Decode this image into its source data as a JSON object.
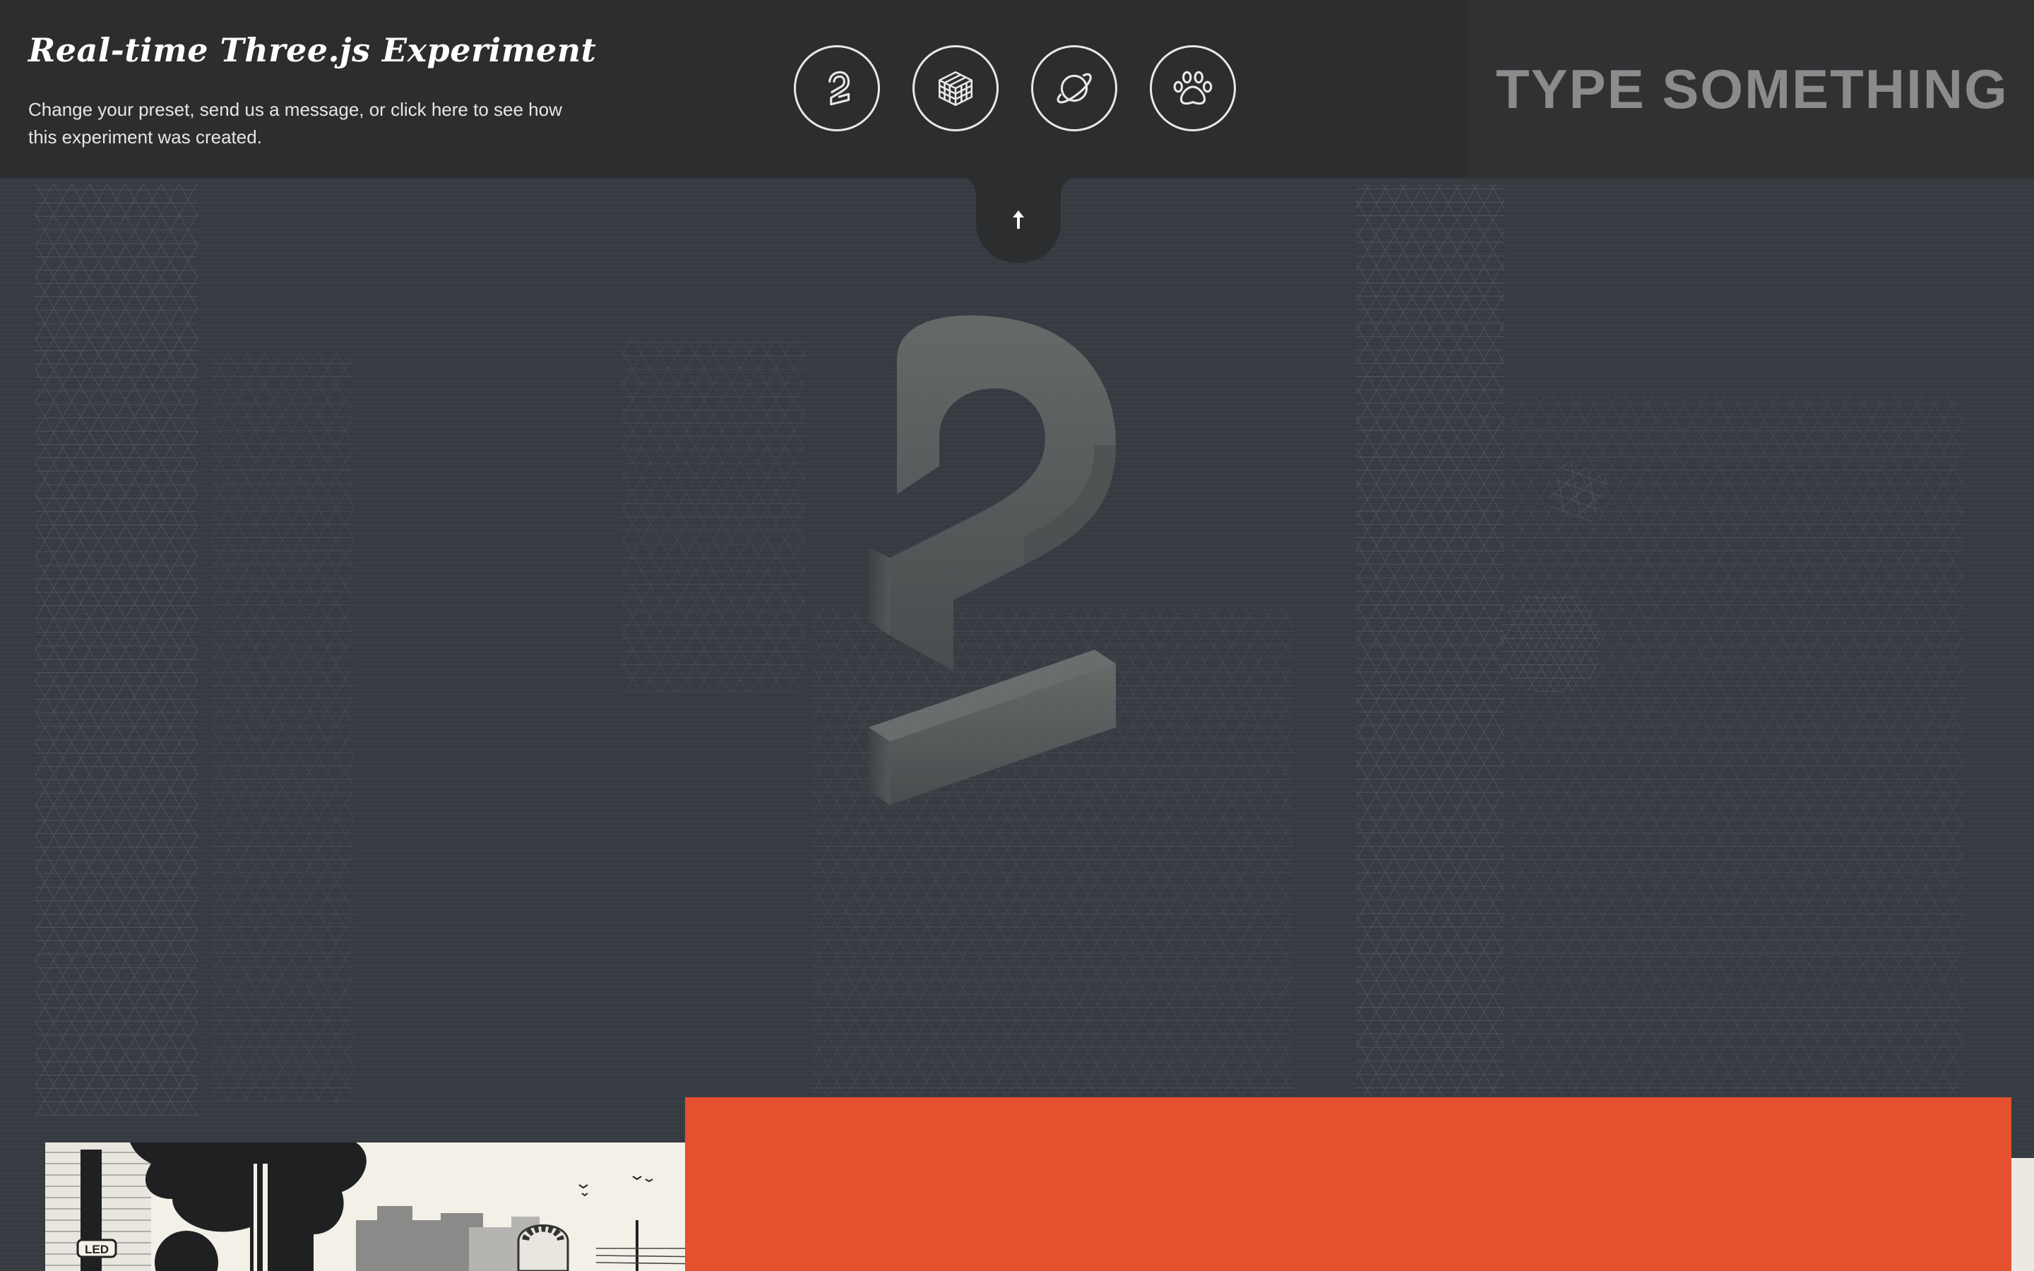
{
  "header": {
    "title": "Real-time Three.js Experiment",
    "description": "Change your preset, send us a message, or click here to see how this experiment was created."
  },
  "presets": [
    {
      "icon": "number-two-icon"
    },
    {
      "icon": "cube-icon"
    },
    {
      "icon": "planet-icon"
    },
    {
      "icon": "paw-icon"
    }
  ],
  "message_input": {
    "placeholder": "TYPE SOMETHING..."
  },
  "collapse_tab": {
    "icon": "arrow-up-icon"
  },
  "colors": {
    "topbar": "#2b2d2f",
    "scene": "#363b42",
    "accent": "#e5502e",
    "placeholder": "#8a8b8c"
  },
  "cards": {
    "city_card_sign": "LED"
  }
}
